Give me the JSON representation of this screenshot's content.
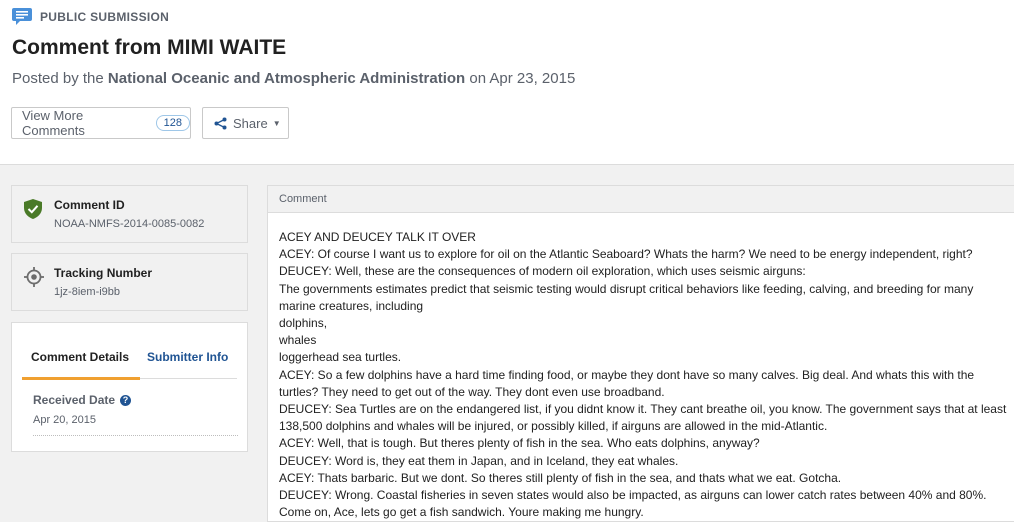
{
  "header": {
    "type_label": "PUBLIC SUBMISSION",
    "title": "Comment from MIMI WAITE",
    "posted_prefix": "Posted by the ",
    "agency": "National Oceanic and Atmospheric Administration",
    "posted_on": " on Apr 23, 2015"
  },
  "actions": {
    "view_more_label": "View More Comments",
    "comment_count": "128",
    "share_label": "Share"
  },
  "sidebar": {
    "comment_id_label": "Comment ID",
    "comment_id_value": "NOAA-NMFS-2014-0085-0082",
    "tracking_label": "Tracking Number",
    "tracking_value": "1jz-8iem-i9bb",
    "tabs": [
      "Comment Details",
      "Submitter Info"
    ],
    "received_label": "Received Date",
    "received_value": "Apr 20, 2015"
  },
  "comment": {
    "heading": "Comment",
    "lines": [
      "ACEY AND DEUCEY TALK IT OVER",
      "ACEY: Of course I want us to explore for oil on the Atlantic Seaboard? Whats the harm? We need to be energy independent, right?",
      "DEUCEY: Well, these are the consequences of modern oil exploration, which uses seismic airguns:",
      "The governments estimates predict that seismic testing would disrupt critical behaviors like feeding, calving, and breeding for many marine creatures, including",
      "dolphins,",
      "whales",
      "loggerhead sea turtles.",
      "ACEY: So a few dolphins have a hard time finding food, or maybe they dont have so many calves. Big deal. And whats this with the turtles? They need to get out of the way. They dont even use broadband.",
      "DEUCEY: Sea Turtles are on the endangered list, if you didnt know it. They cant breathe oil, you know. The government says that at least 138,500 dolphins and whales will be injured, or possibly killed, if airguns are allowed in the mid-Atlantic.",
      "ACEY: Well, that is tough. But theres plenty of fish in the sea. Who eats dolphins, anyway?",
      "DEUCEY: Word is, they eat them in Japan, and in Iceland, they eat whales.",
      "ACEY: Thats barbaric. But we dont. So theres still plenty of fish in the sea, and thats what we eat. Gotcha.",
      "DEUCEY: Wrong. Coastal fisheries in seven states would also be impacted, as airguns can lower catch rates between 40% and 80%.",
      "Come on, Ace, lets go get a fish sandwich. Youre making me hungry."
    ]
  },
  "colors": {
    "accent_blue": "#205493",
    "tab_underline": "#f0a030",
    "shield_green": "#4a7a28"
  },
  "icons": [
    "comment-icon",
    "shield-check-icon",
    "crosshair-icon",
    "share-icon",
    "help-icon",
    "caret-down-icon"
  ]
}
